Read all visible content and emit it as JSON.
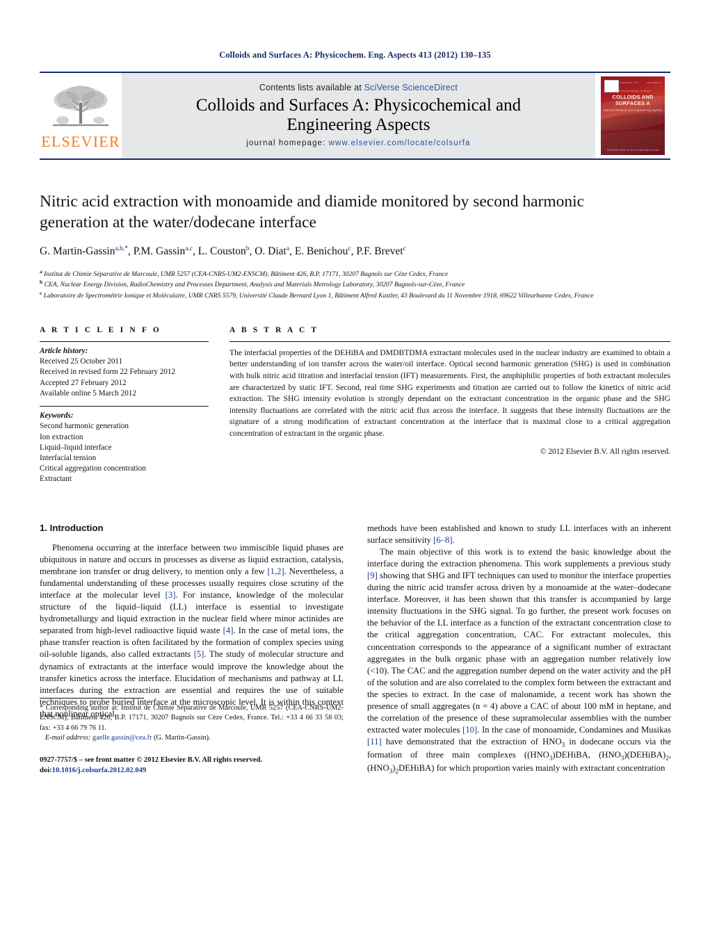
{
  "running_head": "Colloids and Surfaces A: Physicochem. Eng. Aspects 413 (2012) 130–135",
  "masthead": {
    "contents_prefix": "Contents lists available at ",
    "sciencedirect": "SciVerse ScienceDirect",
    "journal_title_line1": "Colloids and Surfaces A: Physicochemical and",
    "journal_title_line2": "Engineering Aspects",
    "homepage_label": "journal homepage:",
    "homepage_url": "www.elsevier.com/locate/colsurfa",
    "publisher_wordmark": "ELSEVIER",
    "cover": {
      "title": "COLLOIDS AND SURFACES A",
      "subtitle": "Physicochemical and Engineering Aspects",
      "tag": "AN INTERNATIONAL JOURNAL",
      "top_left": "ISSN 0927-7757",
      "top_right": "VOLUME 413",
      "bottom": "Available online at www.sciencedirect.com"
    },
    "accent_color": "#1b2a6b",
    "band_color": "#e6e7e9",
    "elsevier_orange": "#f47c20"
  },
  "article": {
    "title": "Nitric acid extraction with monoamide and diamide monitored by second harmonic generation at the water/dodecane interface",
    "authors_html": "G. Martin-Gassin<sup>a,b,</sup><sup class=\"plain\">*</sup>, P.M. Gassin<sup>a,c</sup>, L. Couston<sup>b</sup>, O. Diat<sup>a</sup>, E. Benichou<sup>c</sup>, P.F. Brevet<sup>c</sup>",
    "affiliations": [
      "Institut de Chimie Séparative de Marcoule, UMR 5257 (CEA-CNRS-UM2-ENSCM), Bâtiment 426, B.P. 17171, 30207 Bagnols sur Cèze Cedex, France",
      "CEA, Nuclear Energy Division, RadioChemistry and Processes Department, Analysis and Materials Metrology Laboratory, 30207 Bagnols-sur-Cèze, France",
      "Laboratoire de Spectrométrie Ionique et Moléculaire, UMR CNRS 5579, Université Claude Bernard Lyon 1, Bâtiment Alfred Kastler, 43 Boulevard du 11 Novembre 1918, 69622 Villeurbanne Cedex, France"
    ],
    "affiliation_markers": [
      "a",
      "b",
      "c"
    ]
  },
  "article_info": {
    "label": "A R T I C L E    I N F O",
    "history_label": "Article history:",
    "history": [
      "Received 25 October 2011",
      "Received in revised form 22 February 2012",
      "Accepted 27 February 2012",
      "Available online 5 March 2012"
    ],
    "keywords_label": "Keywords:",
    "keywords": [
      "Second harmonic generation",
      "Ion extraction",
      "Liquid–liquid interface",
      "Interfacial tension",
      "Critical aggregation concentration",
      "Extractant"
    ]
  },
  "abstract": {
    "label": "A B S T R A C T",
    "text": "The interfacial properties of the DEHiBA and DMDBTDMA extractant molecules used in the nuclear industry are examined to obtain a better understanding of ion transfer across the water/oil interface. Optical second harmonic generation (SHG) is used in combination with bulk nitric acid titration and interfacial tension (IFT) measurements. First, the amphiphilic properties of both extractant molecules are characterized by static IFT. Second, real time SHG experiments and titration are carried out to follow the kinetics of nitric acid extraction. The SHG intensity evolution is strongly dependant on the extractant concentration in the organic phase and the SHG intensity fluctuations are correlated with the nitric acid flux across the interface. It suggests that these intensity fluctuations are the signature of a strong modification of extractant concentration at the interface that is maximal close to a critical aggregation concentration of extractant in the organic phase.",
    "copyright": "© 2012 Elsevier B.V. All rights reserved."
  },
  "body": {
    "section_heading": "1.  Introduction",
    "left_paragraphs": [
      "Phenomena occurring at the interface between two immiscible liquid phases are ubiquitous in nature and occurs in processes as diverse as liquid extraction, catalysis, membrane ion transfer or drug delivery, to mention only a few [1,2]. Nevertheless, a fundamental understanding of these processes usually requires close scrutiny of the interface at the molecular level [3]. For instance, knowledge of the molecular structure of the liquid–liquid (LL) interface is essential to investigate hydrometallurgy and liquid extraction in the nuclear field where minor actinides are separated from high-level radioactive liquid waste [4]. In the case of metal ions, the phase transfer reaction is often facilitated by the formation of complex species using oil-soluble ligands, also called extractants [5]. The study of molecular structure and dynamics of extractants at the interface would improve the knowledge about the transfer kinetics across the interface. Elucidation of mechanisms and pathway at LL interfaces during the extraction are essential and requires the use of suitable techniques to probe buried interface at the microscopic level. It is within this context that nonlinear optical"
    ],
    "right_paragraphs": [
      "methods have been established and known to study LL interfaces with an inherent surface sensitivity [6–8].",
      "The main objective of this work is to extend the basic knowledge about the interface during the extraction phenomena. This work supplements a previous study [9] showing that SHG and IFT techniques can used to monitor the interface properties during the nitric acid transfer across driven by a monoamide at the water–dodecane interface. Moreover, it has been shown that this transfer is accompanied by large intensity fluctuations in the SHG signal. To go further, the present work focuses on the behavior of the LL interface as a function of the extractant concentration close to the critical aggregation concentration, CAC. For extractant molecules, this concentration corresponds to the appearance of a significant number of extractant aggregates in the bulk organic phase with an aggregation number relatively low (<10). The CAC and the aggregation number depend on the water activity and the pH of the solution and are also correlated to the complex form between the extractant and the species to extract. In the case of malonamide, a recent work has shown the presence of small aggregates (n = 4) above a CAC of about 100 mM in heptane, and the correlation of the presence of these supramolecular assemblies with the number extracted water molecules [10]. In the case of monoamide, Condamines and Musikas [11] have demonstrated that the extraction of HNO3 in dodecane occurs via the formation of three main complexes ((HNO3)DEHiBA, (HNO3)(DEHiBA)2, (HNO3)2DEHiBA) for which proportion varies mainly with extractant concentration"
    ]
  },
  "footnote": {
    "star": "*",
    "corresponding": "Corresponding author at: Institut de Chimie Séparative de Marcoule, UMR 5257 (CEA-CNRS-UM2-ENSCM), Bâtiment 426, B.P. 17171, 30207 Bagnols sur Cèze Cedex, France. Tel.: +33 4 66 33 58 03; fax: +33 4 66 79 76 11.",
    "email_label": "E-mail address:",
    "email": "gaelle.gassin@cea.fr",
    "email_owner": "(G. Martin-Gassin).",
    "issn_line": "0927-7757/$ – see front matter © 2012 Elsevier B.V. All rights reserved.",
    "doi_label": "doi:",
    "doi_value": "10.1016/j.colsurfa.2012.02.049"
  }
}
